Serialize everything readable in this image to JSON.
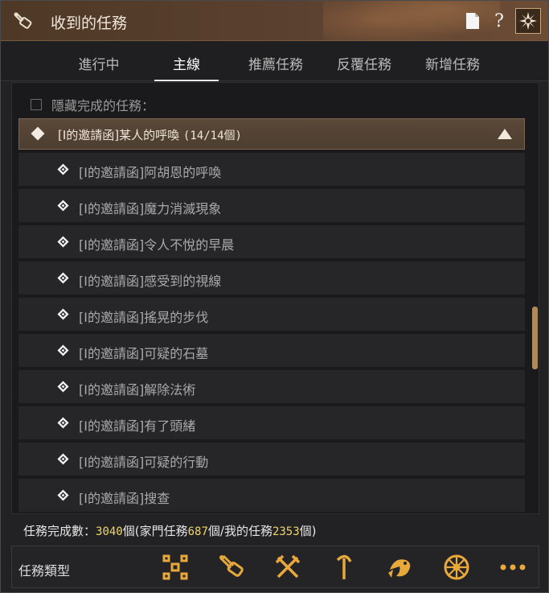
{
  "window": {
    "title": "收到的任務"
  },
  "tabs": [
    {
      "label": "進行中"
    },
    {
      "label": "主線"
    },
    {
      "label": "推薦任務"
    },
    {
      "label": "反覆任務"
    },
    {
      "label": "新增任務"
    }
  ],
  "filter": {
    "hide_completed_label": "隱藏完成的任務："
  },
  "group": {
    "label": "[I的邀請函]某人的呼喚",
    "count": "(14/14個)"
  },
  "quests": [
    {
      "label": "[I的邀請函]阿胡恩的呼喚"
    },
    {
      "label": "[I的邀請函]魔力消滅現象"
    },
    {
      "label": "[I的邀請函]令人不悅的早晨"
    },
    {
      "label": "[I的邀請函]感受到的視線"
    },
    {
      "label": "[I的邀請函]搖晃的步伐"
    },
    {
      "label": "[I的邀請函]可疑的石墓"
    },
    {
      "label": "[I的邀請函]解除法術"
    },
    {
      "label": "[I的邀請函]有了頭緒"
    },
    {
      "label": "[I的邀請函]可疑的行動"
    },
    {
      "label": "[I的邀請函]搜查"
    }
  ],
  "stats": {
    "prefix": "任務完成數：",
    "total": "3040",
    "part1": "個(家門任務",
    "family": "687",
    "part2": "個/我的任務",
    "mine": "2353",
    "part3": "個)"
  },
  "quest_types": {
    "label": "任務類型",
    "icons": [
      "all-types-icon",
      "scroll-icon",
      "combat-icon",
      "gathering-icon",
      "fishing-icon",
      "sailing-icon",
      "more-icon"
    ]
  },
  "colors": {
    "accent_gold": "#f0d56a",
    "titlebar_brown": "#5b4130",
    "scrollbar": "#b08a5a"
  }
}
